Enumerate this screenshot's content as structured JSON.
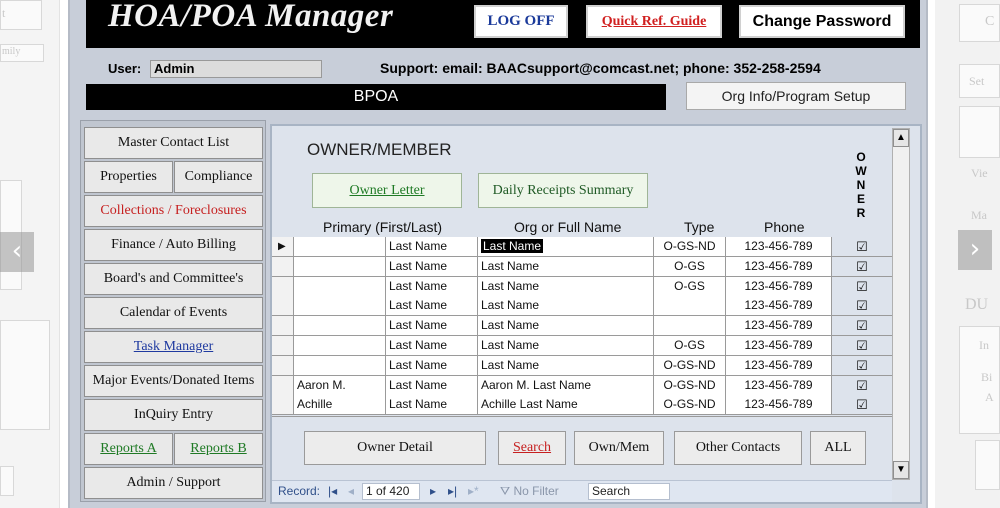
{
  "window": {
    "app_title": "HOA/POA Manager",
    "logoff_label": "LOG OFF",
    "quick_ref_label": "Quick Ref. Guide",
    "change_password_label": "Change Password"
  },
  "user_bar": {
    "user_label": "User:",
    "user_value": "Admin",
    "support_text": "Support: email: BAACsupport@comcast.net; phone: 352-258-2594"
  },
  "org": {
    "name": "BPOA",
    "setup_button": "Org Info/Program Setup"
  },
  "menu": {
    "master_contact_list": "Master Contact List",
    "properties": "Properties",
    "compliance": "Compliance",
    "collections": "Collections / Foreclosures",
    "finance": "Finance / Auto Billing",
    "boards": "Board's and Committee's",
    "calendar": "Calendar of Events",
    "task_manager": "Task Manager",
    "major_events": "Major Events/Donated Items",
    "inquiry": "InQuiry Entry",
    "reports_a": "Reports A",
    "reports_b": "Reports B",
    "admin_support": "Admin / Support"
  },
  "panel": {
    "title": "OWNER/MEMBER",
    "owner_letter_button": "Owner Letter",
    "daily_receipts_button": "Daily Receipts Summary",
    "owner_vertical": [
      "O",
      "W",
      "N",
      "E",
      "R"
    ],
    "columns": {
      "primary": "Primary (First/Last)",
      "org": "Org or Full Name",
      "type": "Type",
      "phone": "Phone"
    },
    "rows": [
      {
        "first": "",
        "last": "Last Name",
        "org": "Last Name",
        "type": "O-GS-ND",
        "phone": "123-456-789",
        "owner": "☑"
      },
      {
        "first": "",
        "last": "Last Name",
        "org": "Last Name",
        "type": "O-GS",
        "phone": "123-456-789",
        "owner": "☑"
      },
      {
        "first": "",
        "last": "Last Name",
        "org": "Last Name",
        "type": "O-GS",
        "phone": "123-456-789",
        "owner": "☑"
      },
      {
        "first": "",
        "last": "Last Name",
        "org": "Last Name",
        "type": "",
        "phone": "123-456-789",
        "owner": "☑"
      },
      {
        "first": "",
        "last": "Last Name",
        "org": "Last Name",
        "type": "",
        "phone": "123-456-789",
        "owner": "☑"
      },
      {
        "first": "",
        "last": "Last Name",
        "org": "Last Name",
        "type": "O-GS",
        "phone": "123-456-789",
        "owner": "☑"
      },
      {
        "first": "",
        "last": "Last Name",
        "org": "Last Name",
        "type": "O-GS-ND",
        "phone": "123-456-789",
        "owner": "☑"
      },
      {
        "first": "Aaron M.",
        "last": "Last Name",
        "org": "Aaron M. Last Name",
        "type": "O-GS-ND",
        "phone": "123-456-789",
        "owner": "☑"
      },
      {
        "first": "Achille",
        "last": "Last Name",
        "org": "Achille Last Name",
        "type": "O-GS-ND",
        "phone": "123-456-789",
        "owner": "☑"
      }
    ],
    "owner_detail_button": "Owner Detail",
    "search_button": "Search",
    "own_mem_button": "Own/Mem",
    "other_contacts_button": "Other Contacts",
    "all_button": "ALL"
  },
  "record_nav": {
    "label": "Record:",
    "position": "1 of 420",
    "no_filter": "No Filter",
    "search_placeholder": "Search"
  },
  "side_left": {
    "text1": "t",
    "text2": "mily"
  },
  "side_right": {
    "c": "C",
    "set": "Set",
    "vie": "Vie",
    "ma": "Ma",
    "du": "DU",
    "in": "In",
    "bi": "Bi",
    "a": "A"
  }
}
